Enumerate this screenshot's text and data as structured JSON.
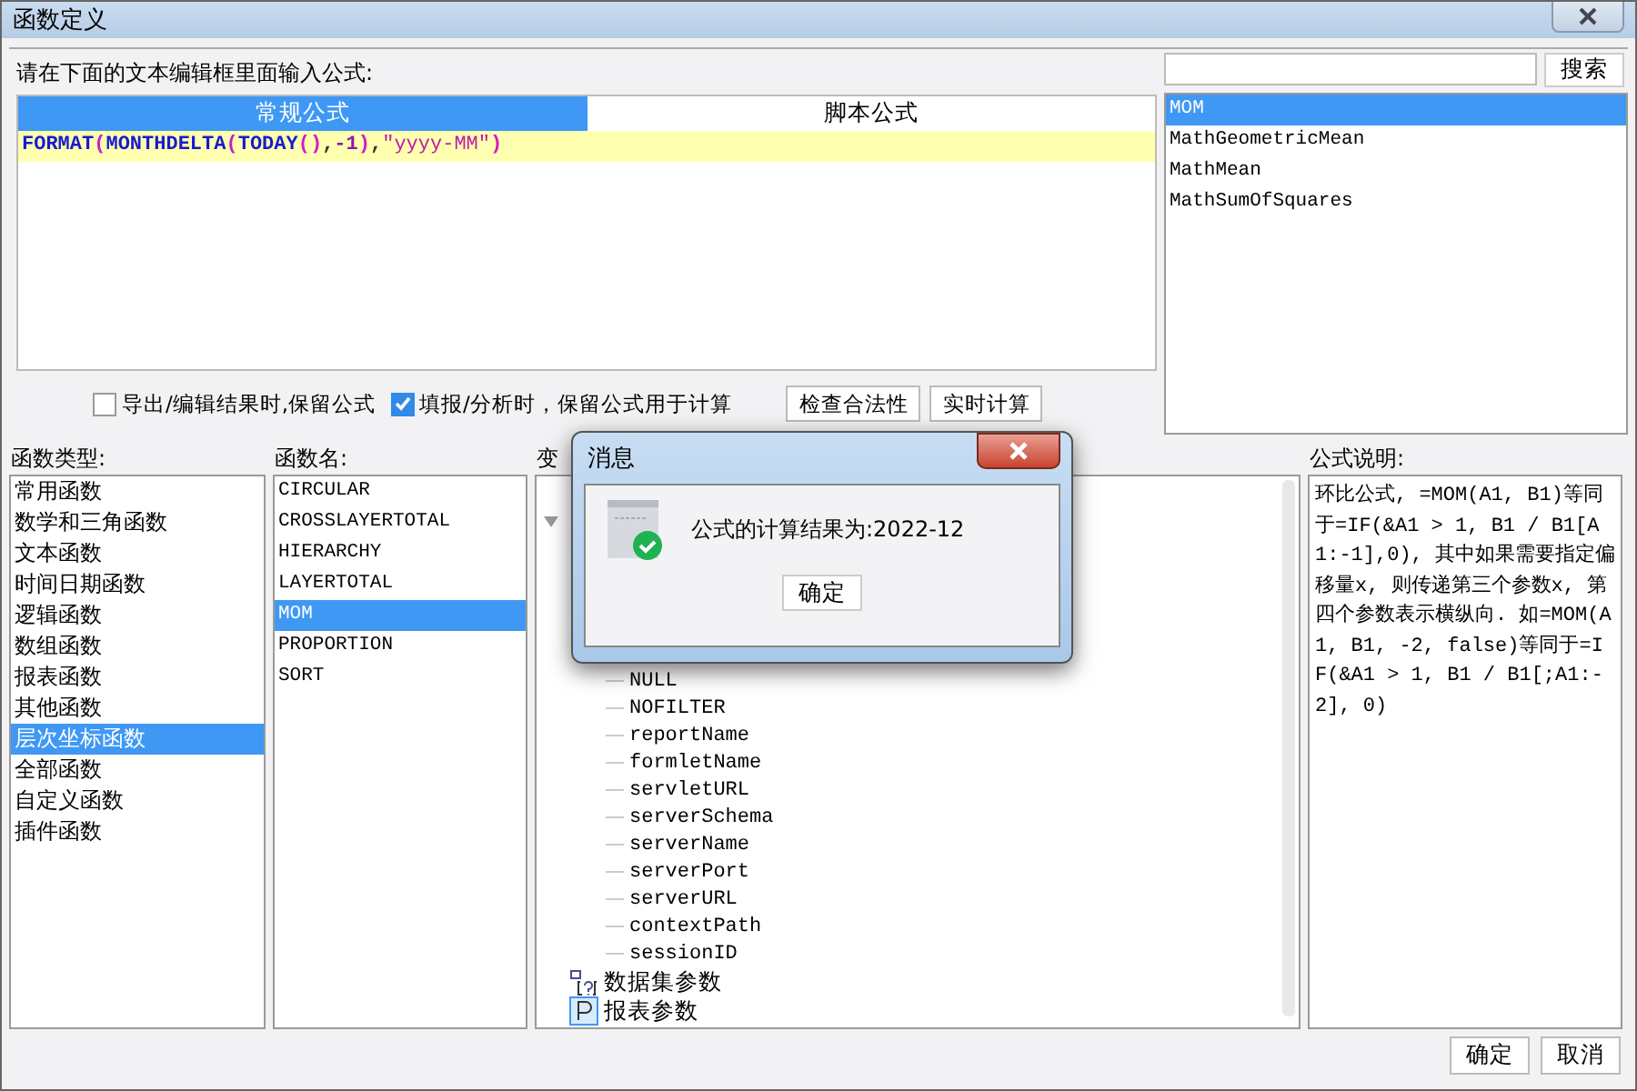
{
  "window": {
    "title": "函数定义"
  },
  "formula_editor": {
    "prompt": "请在下面的文本编辑框里面输入公式:",
    "tabs": [
      {
        "label": "常规公式",
        "selected": true
      },
      {
        "label": "脚本公式",
        "selected": false
      }
    ],
    "tokens": [
      {
        "text": "FORMAT",
        "kind": "function"
      },
      {
        "text": "(",
        "kind": "paren"
      },
      {
        "text": "MONTHDELTA",
        "kind": "function"
      },
      {
        "text": "(",
        "kind": "paren"
      },
      {
        "text": "TODAY",
        "kind": "function"
      },
      {
        "text": "()",
        "kind": "paren"
      },
      {
        "text": ",",
        "kind": "punct"
      },
      {
        "text": "-1",
        "kind": "number"
      },
      {
        "text": ")",
        "kind": "paren"
      },
      {
        "text": ",",
        "kind": "punct"
      },
      {
        "text": "\"yyyy-MM\"",
        "kind": "string"
      },
      {
        "text": ")",
        "kind": "paren"
      }
    ]
  },
  "search": {
    "button": "搜索",
    "results": [
      {
        "label": "MOM",
        "selected": true
      },
      {
        "label": "MathGeometricMean",
        "selected": false
      },
      {
        "label": "MathMean",
        "selected": false
      },
      {
        "label": "MathSumOfSquares",
        "selected": false
      }
    ]
  },
  "options": [
    {
      "label": "导出/编辑结果时,保留公式",
      "checked": false
    },
    {
      "label": "填报/分析时，保留公式用于计算",
      "checked": true
    }
  ],
  "actions": [
    "检查合法性",
    "实时计算"
  ],
  "function_types": {
    "label": "函数类型:",
    "items": [
      {
        "label": "常用函数",
        "selected": false
      },
      {
        "label": "数学和三角函数",
        "selected": false
      },
      {
        "label": "文本函数",
        "selected": false
      },
      {
        "label": "时间日期函数",
        "selected": false
      },
      {
        "label": "逻辑函数",
        "selected": false
      },
      {
        "label": "数组函数",
        "selected": false
      },
      {
        "label": "报表函数",
        "selected": false
      },
      {
        "label": "其他函数",
        "selected": false
      },
      {
        "label": "层次坐标函数",
        "selected": true
      },
      {
        "label": "全部函数",
        "selected": false
      },
      {
        "label": "自定义函数",
        "selected": false
      },
      {
        "label": "插件函数",
        "selected": false
      }
    ]
  },
  "function_names": {
    "label": "函数名:",
    "items": [
      {
        "label": "CIRCULAR",
        "selected": false
      },
      {
        "label": "CROSSLAYERTOTAL",
        "selected": false
      },
      {
        "label": "HIERARCHY",
        "selected": false
      },
      {
        "label": "LAYERTOTAL",
        "selected": false
      },
      {
        "label": "MOM",
        "selected": true
      },
      {
        "label": "PROPORTION",
        "selected": false
      },
      {
        "label": "SORT",
        "selected": false
      }
    ]
  },
  "variables": {
    "label": "变",
    "children": [
      "NULL",
      "NOFILTER",
      "reportName",
      "formletName",
      "servletURL",
      "serverSchema",
      "serverName",
      "serverPort",
      "serverURL",
      "contextPath",
      "sessionID"
    ],
    "nodes": [
      {
        "label": "数据集参数",
        "kind": "dataset"
      },
      {
        "label": "报表参数",
        "kind": "param"
      }
    ]
  },
  "description": {
    "label": "公式说明:",
    "text": "环比公式, =MOM(A1, B1)等同于=IF(&A1 > 1, B1 / B1[A1:-1],0), 其中如果需要指定偏移量x, 则传递第三个参数x, 第四个参数表示横纵向. 如=MOM(A1, B1, -2, false)等同于=IF(&A1 > 1, B1 / B1[;A1:-2], 0)"
  },
  "buttons": [
    "确定",
    "取消"
  ],
  "message_dialog": {
    "title": "消息",
    "text": "公式的计算结果为:2022-12",
    "button": "确定"
  }
}
